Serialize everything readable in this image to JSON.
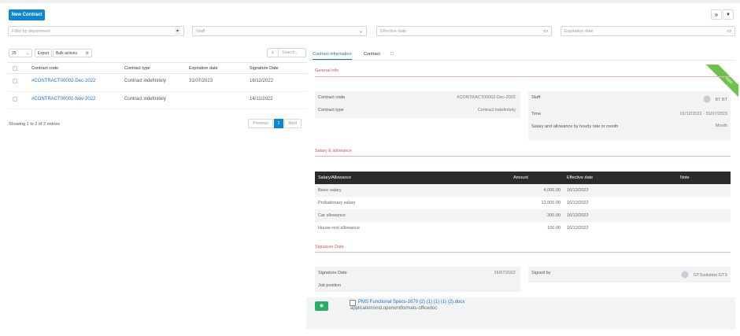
{
  "toolbar": {
    "new_contract": "New Contract",
    "expand_icon": "»",
    "filter_icon": "▼"
  },
  "filters": {
    "department_placeholder": "Filter by department",
    "staff_placeholder": "Staff",
    "effective_date_placeholder": "Effective date",
    "expiration_date_placeholder": "Expiration date"
  },
  "table_controls": {
    "page_size": "25",
    "export": "Export",
    "bulk_actions": "Bulk actions",
    "search_placeholder": "Search..."
  },
  "contracts_table": {
    "columns": [
      "Contract code",
      "Contract type",
      "Expiration date",
      "Signature Date"
    ],
    "rows": [
      {
        "code": "#CONTRACT00002-Dec-2022",
        "type": "Contract indefinitely",
        "expiration": "31/07/2023",
        "signature": "16/12/2022"
      },
      {
        "code": "#CONTRACT00001-Nov-2022",
        "type": "Contract indefinitely",
        "expiration": "",
        "signature": "14/11/2022"
      }
    ],
    "summary": "Showing 1 to 2 of 2 entries",
    "prev": "Previous",
    "page": "1",
    "next": "Next"
  },
  "detail": {
    "tabs": [
      "Contract information",
      "Contract"
    ],
    "ribbon": "Valid",
    "general_title": "General info",
    "contract_code_label": "Contract code",
    "contract_code_value": "#CONTRACT00002-Dec-2022",
    "contract_type_label": "Contract type",
    "contract_type_value": "Contract indefinitely",
    "staff_label": "Staff",
    "staff_value": "BT BT",
    "time_label": "Time",
    "time_value": "01/12/2022 - 31/07/2023",
    "salary_basis_label": "Salary and allowance by hourly rate or month",
    "salary_basis_value": "Month",
    "salary_title": "Salary & allowance",
    "salary_columns": [
      "Salary/Allowance",
      "Amount",
      "Effective date",
      "Note"
    ],
    "salary_rows": [
      {
        "name": "Basic salary",
        "amount": "4,000.00",
        "date": "16/12/2022"
      },
      {
        "name": "Probationary salary",
        "amount": "12,000.00",
        "date": "16/12/2022"
      },
      {
        "name": "Car allowance",
        "amount": "300.00",
        "date": "16/12/2022"
      },
      {
        "name": "House rent allowance",
        "amount": "100.00",
        "date": "16/12/2022"
      }
    ],
    "signature_title": "Signature Date",
    "signature_date_label": "Signature Date",
    "signature_date_value": "16/07/2022",
    "signed_by_label": "Signed by",
    "signed_by_value": "GTSsolution GTS",
    "job_position_label": "Job position",
    "file_name": "PMS Functional Specs-1670 (2) (1) (1) (1) (2).docx",
    "file_type": "application/vnd.openxmlformats-officedoc"
  },
  "colors": {
    "primary": "#0d86d1",
    "accent_red": "#d9534f",
    "ribbon_green": "#6cc24a",
    "file_green": "#27ae60"
  }
}
